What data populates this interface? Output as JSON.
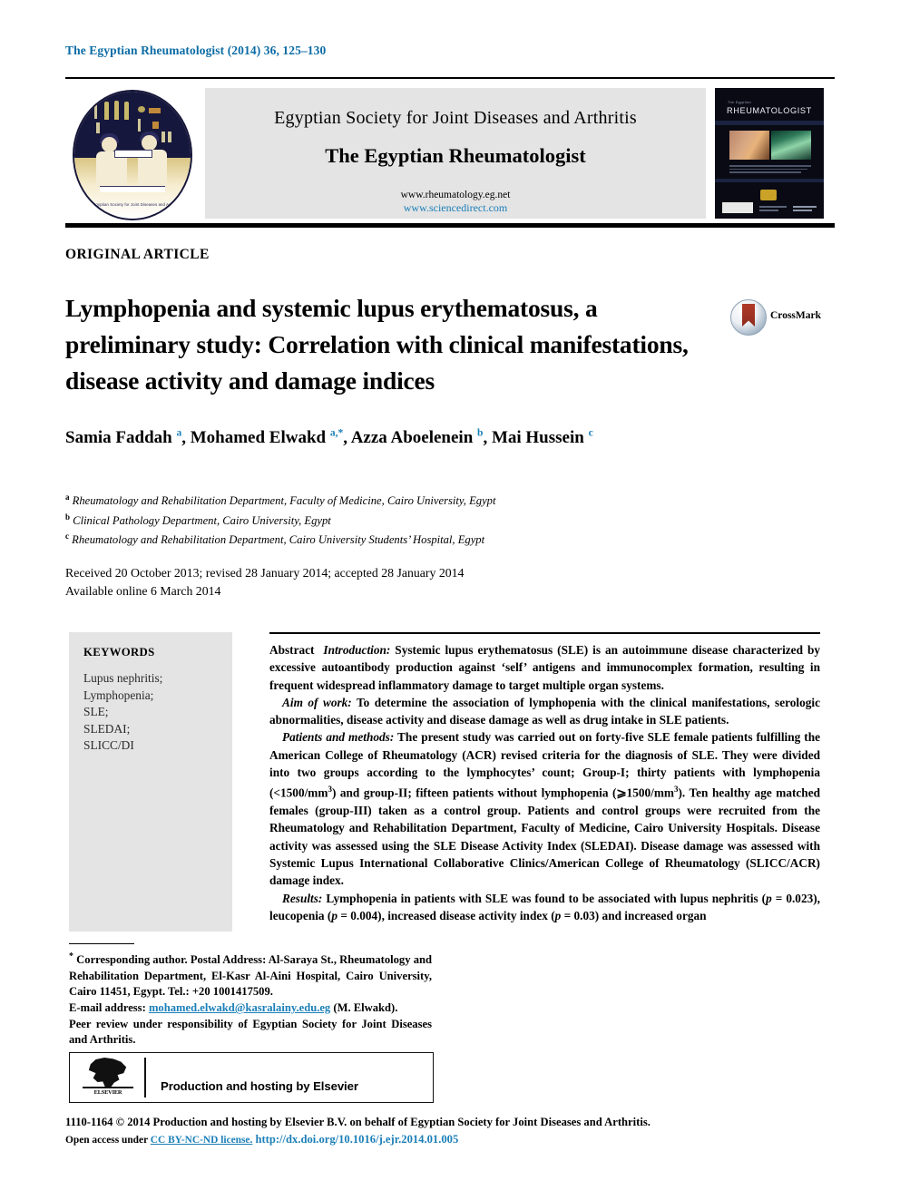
{
  "running_head": "The Egyptian Rheumatologist (2014) 36, 125–130",
  "masthead": {
    "society": "Egyptian Society for Joint Diseases and Arthritis",
    "journal_title": "The Egyptian Rheumatologist",
    "url_journal": "www.rheumatology.eg.net",
    "url_sciencedirect": "www.sciencedirect.com",
    "logo_caption": "The Egyptian Society for Joint Diseases and Arthritis",
    "cover": {
      "kicker": "The Egyptian",
      "title": "RHEUMATOLOGIST"
    }
  },
  "article": {
    "kind": "ORIGINAL ARTICLE",
    "title": "Lymphopenia and systemic lupus erythematosus, a preliminary study: Correlation with clinical manifestations, disease activity and damage indices",
    "crossmark_label": "CrossMark",
    "authors": [
      {
        "name": "Samia Faddah",
        "marks": "a"
      },
      {
        "name": "Mohamed Elwakd",
        "marks": "a,*"
      },
      {
        "name": "Azza Aboelenein",
        "marks": "b"
      },
      {
        "name": "Mai Hussein",
        "marks": "c"
      }
    ],
    "affiliations": [
      {
        "mark": "a",
        "text": "Rheumatology and Rehabilitation Department, Faculty of Medicine, Cairo University, Egypt"
      },
      {
        "mark": "b",
        "text": "Clinical Pathology Department, Cairo University, Egypt"
      },
      {
        "mark": "c",
        "text": "Rheumatology and Rehabilitation Department, Cairo University Students’ Hospital, Egypt"
      }
    ],
    "dates_received": "Received 20 October 2013; revised 28 January 2014; accepted 28 January 2014",
    "dates_online": "Available online 6 March 2014"
  },
  "keywords": {
    "heading": "KEYWORDS",
    "items": "Lupus nephritis;\nLymphopenia;\nSLE;\nSLEDAI;\nSLICC/DI"
  },
  "abstract": {
    "label": "Abstract",
    "sections": [
      {
        "heading": "Introduction:",
        "text": " Systemic lupus erythematosus (SLE) is an autoimmune disease characterized by excessive autoantibody production against ‘self’ antigens and immunocomplex formation, resulting in frequent widespread inflammatory damage to target multiple organ systems."
      },
      {
        "heading": "Aim of work:",
        "text": " To determine the association of lymphopenia with the clinical manifestations, serologic abnormalities, disease activity and disease damage as well as drug intake in SLE patients."
      },
      {
        "heading": "Patients and methods:",
        "text_1": " The present study was carried out on forty-five SLE female patients fulfilling the American College of Rheumatology (ACR) revised criteria for the diagnosis of SLE. They were divided into two groups according to the lymphocytes’ count; Group-I; thirty patients with lymphopenia (<1500/mm",
        "sup_1": "3",
        "text_2": ") and group-II; fifteen patients without lymphopenia (⩾1500/mm",
        "sup_2": "3",
        "text_3": "). Ten healthy age matched females (group-III) taken as a control group. Patients and control groups were recruited from the Rheumatology and Rehabilitation Department, Faculty of Medicine, Cairo University Hospitals. Disease activity was assessed using the SLE Disease Activity Index (SLEDAI). Disease damage was assessed with Systemic Lupus International Collaborative Clinics/American College of Rheumatology (SLICC/ACR) damage index."
      },
      {
        "heading": "Results:",
        "text": " Lymphopenia in patients with SLE was found to be associated with lupus nephritis (p = 0.023), leucopenia (p = 0.004), increased disease activity index (p = 0.03) and increased organ"
      }
    ]
  },
  "footnote": {
    "corresponding": "Corresponding author. Postal Address: Al-Saraya St., Rheumatology and Rehabilitation Department, El-Kasr Al-Aini Hospital, Cairo University, Cairo 11451, Egypt. Tel.: +20 1001417509.",
    "email_label": "E-mail address:",
    "email": "mohamed.elwakd@kasralainy.edu.eg",
    "email_suffix": "(M. Elwakd).",
    "peer_review": "Peer review under responsibility of Egyptian Society for Joint Diseases and Arthritis."
  },
  "elsevier_box": {
    "wordmark": "ELSEVIER",
    "text": "Production and hosting by Elsevier"
  },
  "copyright": {
    "line1": "1110-1164 © 2014 Production and hosting by Elsevier B.V. on behalf of Egyptian Society for Joint Diseases and Arthritis.",
    "open_access_prefix": "Open access under ",
    "license": "CC BY-NC-ND license.",
    "doi": "http://dx.doi.org/10.1016/j.ejr.2014.01.005"
  },
  "colors": {
    "link_blue": "#1b7fb8",
    "runhead_blue": "#0c6ca5",
    "panel_gray": "#e4e4e4"
  }
}
